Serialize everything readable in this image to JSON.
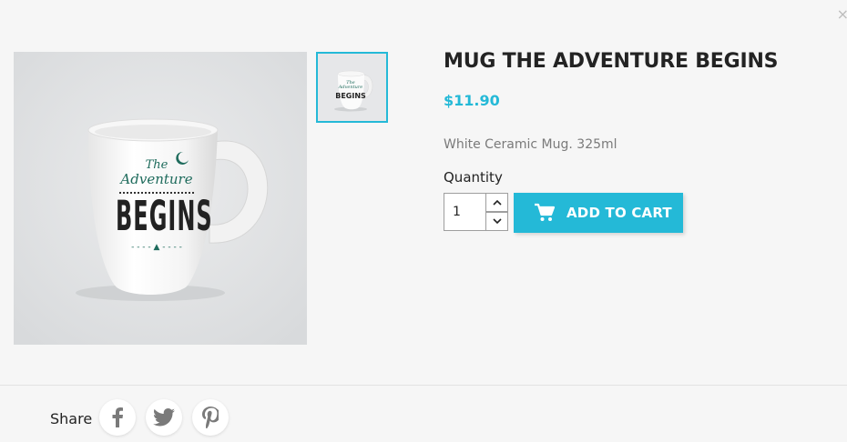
{
  "modal": {
    "close_symbol": "×"
  },
  "product": {
    "title": "MUG THE ADVENTURE BEGINS",
    "price": "$11.90",
    "description": "White Ceramic Mug. 325ml",
    "image_text": {
      "line1": "The",
      "line2": "Adventure",
      "line3": "BEGINS"
    }
  },
  "quantity": {
    "label": "Quantity",
    "value": "1"
  },
  "cart": {
    "button_label": "ADD TO CART",
    "icon": "shopping-cart-icon"
  },
  "share": {
    "label": "Share",
    "networks": [
      "facebook-icon",
      "twitter-icon",
      "pinterest-icon"
    ]
  },
  "colors": {
    "accent": "#24b9d7",
    "mug_text_green": "#1e6b5c",
    "text_dark": "#232323"
  }
}
